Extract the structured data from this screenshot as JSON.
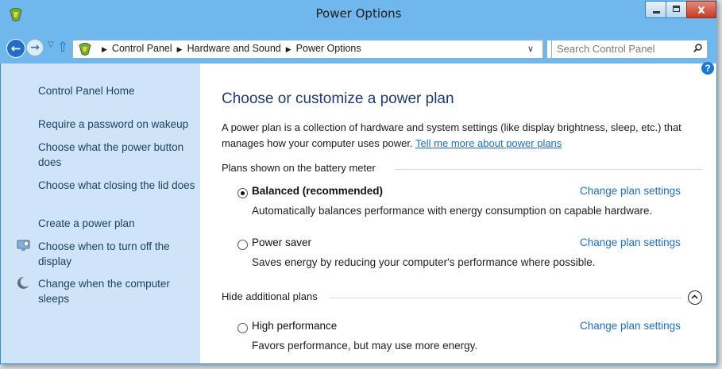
{
  "window": {
    "title": "Power Options",
    "colors": {
      "frame": "#6fb7ec",
      "sidebar": "#cfe5f7",
      "link": "#1a6fc4",
      "heading": "#1e3a6d"
    }
  },
  "toolbar": {
    "back_icon": "back-arrow-icon",
    "forward_icon": "forward-arrow-icon",
    "up_icon": "up-arrow-icon",
    "breadcrumb": [
      "Control Panel",
      "Hardware and Sound",
      "Power Options"
    ],
    "search_placeholder": "Search Control Panel"
  },
  "sidebar": {
    "items": [
      {
        "label": "Control Panel Home"
      },
      {
        "label": "Require a password on wakeup"
      },
      {
        "label": "Choose what the power button does"
      },
      {
        "label": "Choose what closing the lid does"
      },
      {
        "label": "Create a power plan"
      },
      {
        "label": "Choose when to turn off the display",
        "icon": "monitor-icon"
      },
      {
        "label": "Change when the computer sleeps",
        "icon": "moon-sleep-icon"
      }
    ]
  },
  "main": {
    "heading": "Choose or customize a power plan",
    "description": "A power plan is a collection of hardware and system settings (like display brightness, sleep, etc.) that manages how your computer uses power.",
    "learn_more_link": "Tell me more about power plans",
    "plans_group_label": "Plans shown on the battery meter",
    "additional_group_label": "Hide additional plans",
    "plans": [
      {
        "name": "Balanced (recommended)",
        "selected": true,
        "change_label": "Change plan settings",
        "description": "Automatically balances performance with energy consumption on capable hardware."
      },
      {
        "name": "Power saver",
        "selected": false,
        "change_label": "Change plan settings",
        "description": "Saves energy by reducing your computer's performance where possible."
      },
      {
        "name": "High performance",
        "selected": false,
        "change_label": "Change plan settings",
        "description": "Favors performance, but may use more energy."
      }
    ]
  }
}
